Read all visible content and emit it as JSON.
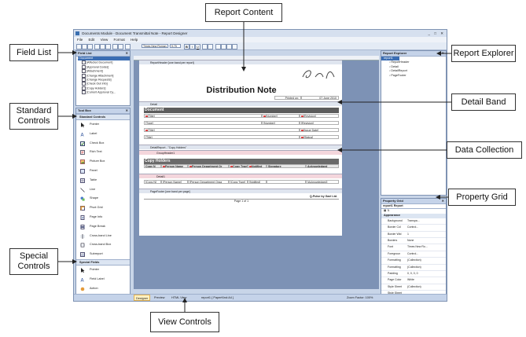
{
  "callouts": {
    "report_content": "Report Content",
    "field_list": "Field List",
    "report_explorer": "Report Explorer",
    "standard_controls": "Standard Controls",
    "detail_band": "Detail Band",
    "data_collection": "Data Collection",
    "property_grid": "Property Grid",
    "special_controls": "Special Controls",
    "view_controls": "View Controls"
  },
  "window": {
    "title": "Documents Module - Document Transmittal Note - Report Designer",
    "menu": [
      "File",
      "Edit",
      "View",
      "Format",
      "Help"
    ],
    "font_name": "Times New Roman",
    "font_size": "9.75"
  },
  "field_list": {
    "header": "Field List",
    "root": "Document",
    "items": [
      "[Affected Document]",
      "[Approval Codes]",
      "[Attachment]",
      "[Change Attachment]",
      "[Change Requests]",
      "[Check Out Info]",
      "[Copy Holders]",
      "[Current Approval Cy..."
    ]
  },
  "toolbox": {
    "header": "Tool Box",
    "standard_header": "Standard Controls",
    "standard": [
      "Pointer",
      "Label",
      "Check Box",
      "Rich Text",
      "Picture Box",
      "Panel",
      "Table",
      "Line",
      "Shape",
      "Pivot Grid",
      "Page Info",
      "Page Break",
      "Cross-band Line",
      "Cross-band Box",
      "Subreport"
    ],
    "special_header": "Special Fields",
    "special": [
      "Pointer",
      "Field Label",
      "Action"
    ]
  },
  "report": {
    "report_header_band": "ReportHeader [one band per report]",
    "logo": "Gael",
    "title": "Distribution Note",
    "printed_on_label": "Printed on:",
    "printed_on_value": "07 June 2010",
    "detail_band": "Detail",
    "document_header": "Document",
    "doc_rows": [
      [
        "[Title]",
        "[Number]",
        "[Revision]"
      ],
      [
        "[Type]",
        "[Number]",
        "[Revision]"
      ],
      [
        "[Title]",
        "",
        "[Issue Date]"
      ],
      [
        "[Title]",
        "",
        "[Status]"
      ]
    ],
    "detail_report_band": "DetailReport - \"Copy Holders\"",
    "group_header_band": "GroupHeader1",
    "copy_holders_header": "Copy Holders",
    "copy_cols": [
      "Copy N",
      "Person Name",
      "Person Department Or",
      "Copy Type",
      "Notified",
      "Signature",
      "Acknowledged"
    ],
    "detail1_band": "Detail1",
    "copy_values": [
      "[Copy N]",
      "[Person Name]",
      "[Person Department Orga",
      "[Copy Type]",
      "[Notified]",
      "",
      "[Acknowledged]"
    ],
    "page_footer_band": "PageFooter [one band per page]",
    "footer_left": "Page 1 of 1",
    "footer_right": "Q-Pulse by Gael Ltd."
  },
  "report_explorer": {
    "header": "Report Explorer",
    "items": [
      "report1",
      "ReportHeader",
      "Detail",
      "DetailReport",
      "PageFooter"
    ]
  },
  "property_grid": {
    "header": "Property Grid",
    "object": "report1  Report",
    "section": "Appearance",
    "rows": [
      [
        "Background",
        "Transpa..."
      ],
      [
        "Border Col",
        "Control..."
      ],
      [
        "Border Wid",
        "1"
      ],
      [
        "Borders",
        "None"
      ],
      [
        "Font",
        "Times New Ro..."
      ],
      [
        "Foregroun",
        "Control..."
      ],
      [
        "Formatting",
        "(Collection)"
      ],
      [
        "Formatting",
        "(Collection)"
      ],
      [
        "Padding",
        "0, 0, 0, 0"
      ],
      [
        "Page Color",
        "White"
      ],
      [
        "Style Sheet",
        "(Collection)"
      ],
      [
        "Style Sheet",
        ""
      ],
      [
        "Text Align",
        "Top Left"
      ],
      [
        "Watermark",
        "(None)"
      ]
    ]
  },
  "status": {
    "tabs": [
      "Designer",
      "Preview",
      "HTML View"
    ],
    "selection": "report1 { PaperKind:A4 }",
    "zoom": "Zoom Factor: 100%"
  },
  "colors": {
    "accent": "#c5d3e9",
    "designer_bg": "#7d92b5",
    "header_dark": "#5c5c5c",
    "band_red": "#f4d6dc"
  },
  "icons": [
    "pointer-icon",
    "label-icon",
    "checkbox-icon",
    "richtext-icon",
    "picturebox-icon",
    "panel-icon",
    "table-icon",
    "line-icon",
    "shape-icon",
    "pivotgrid-icon",
    "pageinfo-icon",
    "pagebreak-icon",
    "crossbandline-icon",
    "crossbandbox-icon",
    "subreport-icon",
    "close-icon"
  ]
}
